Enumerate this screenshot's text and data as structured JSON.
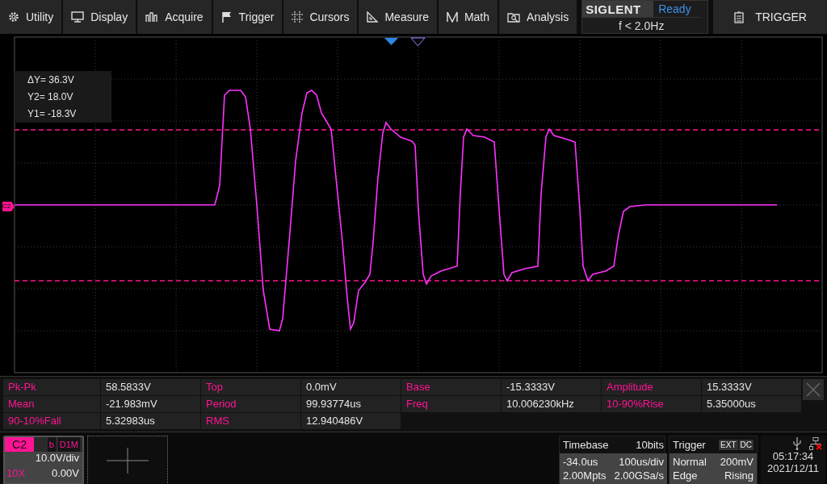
{
  "menu": [
    {
      "label": "Utility"
    },
    {
      "label": "Display"
    },
    {
      "label": "Acquire"
    },
    {
      "label": "Trigger"
    },
    {
      "label": "Cursors"
    },
    {
      "label": "Measure"
    },
    {
      "label": "Math"
    },
    {
      "label": "Analysis"
    }
  ],
  "brand": {
    "logo": "SIGLENT",
    "status": "Ready",
    "frequency": "f < 2.0Hz"
  },
  "side_panel": {
    "title": "TRIGGER"
  },
  "cursor_readout": [
    "ΔY= 36.3V",
    "Y2= 18.0V",
    "Y1= -18.3V"
  ],
  "channel_marker": "C2",
  "measurements": [
    {
      "label": "Pk-Pk",
      "value": "58.5833V"
    },
    {
      "label": "Top",
      "value": "0.0mV"
    },
    {
      "label": "Base",
      "value": "-15.3333V"
    },
    {
      "label": "Amplitude",
      "value": "15.3333V"
    },
    {
      "label": "Mean",
      "value": "-21.983mV"
    },
    {
      "label": "Period",
      "value": "99.93774us"
    },
    {
      "label": "Freq",
      "value": "10.006230kHz"
    },
    {
      "label": "10-90%Rise",
      "value": "5.35000us"
    },
    {
      "label": "90-10%Fall",
      "value": "5.32983us"
    },
    {
      "label": "RMS",
      "value": "12.940486V"
    }
  ],
  "channel": {
    "name": "C2",
    "bandwidth": "b",
    "coupling": "D1M",
    "scale": "10.0V/div",
    "probe": "10X",
    "offset": "0.00V"
  },
  "timebase": {
    "title": "Timebase",
    "bits": "10bits",
    "delay": "-34.0us",
    "scale": "100us/div",
    "memory": "2.00Mpts",
    "sample_rate": "2.00GSa/s"
  },
  "trigger": {
    "title": "Trigger",
    "source": "EXT",
    "coupling": "DC",
    "mode": "Normal",
    "level": "200mV",
    "type": "Edge",
    "slope": "Rising"
  },
  "clock": {
    "time": "05:17:34",
    "date": "2021/12/11"
  }
}
